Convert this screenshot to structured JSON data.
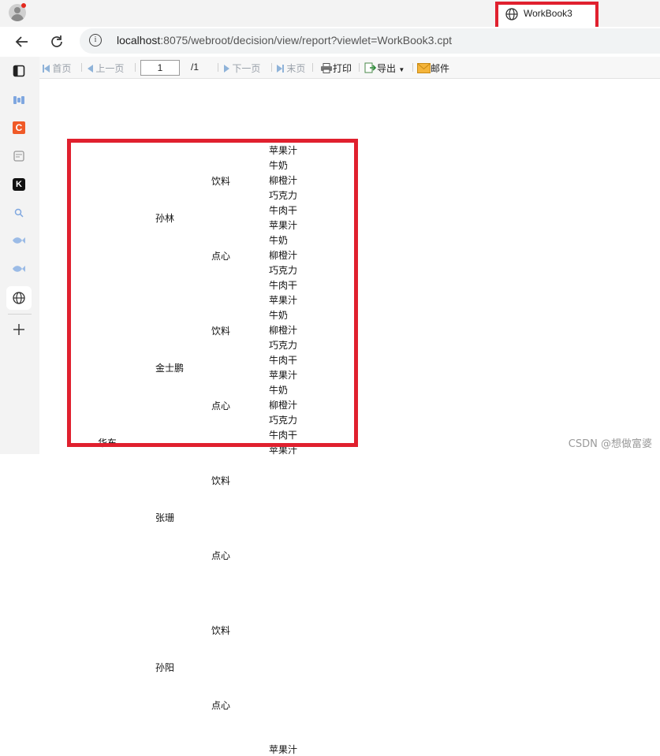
{
  "browser": {
    "tab_title": "WorkBook3",
    "url_host": "localhost",
    "url_rest": ":8075/webroot/decision/view/report?viewlet=WorkBook3.cpt"
  },
  "toolbar": {
    "first": "首页",
    "prev": "上一页",
    "page_value": "1",
    "page_total": "/1",
    "next": "下一页",
    "last": "末页",
    "print": "打印",
    "export": "导出",
    "mail": "邮件"
  },
  "report": {
    "region": "华东",
    "people": [
      "孙林",
      "金士鹏",
      "张珊",
      "孙阳"
    ],
    "categories": [
      "饮料",
      "点心"
    ],
    "products": [
      "苹果汁",
      "牛奶",
      "柳橙汁",
      "巧克力",
      "牛肉干"
    ]
  },
  "watermark": "CSDN @想做富婆",
  "colors": {
    "highlight": "#e0202e",
    "toolbar_bg": "#f7f7f7",
    "chrome_bg": "#f3f3f3"
  }
}
